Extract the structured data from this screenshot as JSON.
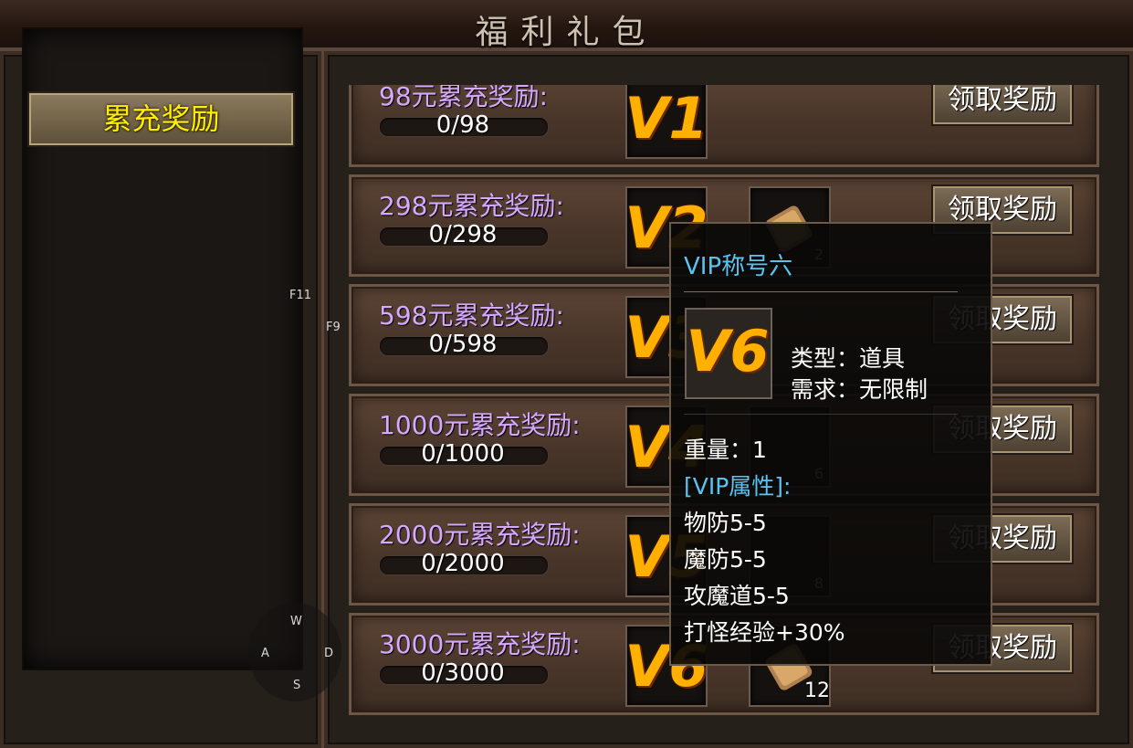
{
  "window": {
    "title": "福利礼包"
  },
  "left_tabs": [
    {
      "label": "累充奖励",
      "active": true
    }
  ],
  "rewards": [
    {
      "label": "98元累充奖励:",
      "progress": "0/98",
      "icon": "V1",
      "claim": "领取奖励"
    },
    {
      "label": "298元累充奖励:",
      "progress": "0/298",
      "icon": "V2",
      "item_count": "2",
      "claim": "领取奖励"
    },
    {
      "label": "598元累充奖励:",
      "progress": "0/598",
      "icon": "V3",
      "claim": "领取奖励"
    },
    {
      "label": "1000元累充奖励:",
      "progress": "0/1000",
      "icon": "V4",
      "item_count": "6",
      "claim": "领取奖励"
    },
    {
      "label": "2000元累充奖励:",
      "progress": "0/2000",
      "icon": "V5",
      "item_count": "8",
      "claim": "领取奖励"
    },
    {
      "label": "3000元累充奖励:",
      "progress": "0/3000",
      "icon": "V6",
      "item_count": "12",
      "claim": "领取奖励"
    }
  ],
  "tooltip": {
    "name": "VIP称号六",
    "icon": "V6",
    "type": "类型：道具",
    "requirement": "需求：无限制",
    "weight": "重量：1",
    "attr_header": "[VIP属性]:",
    "attrs": [
      "物防5-5",
      "魔防5-5",
      "攻魔道5-5",
      "打怪经验+30%"
    ]
  },
  "hotkeys": {
    "f11": "F11",
    "f9": "F9",
    "w": "W",
    "a": "A",
    "s": "S",
    "d": "D"
  },
  "colors": {
    "label": "#d6a8ff",
    "tab_text": "#ffee00",
    "tooltip_name": "#5bc3f0"
  }
}
